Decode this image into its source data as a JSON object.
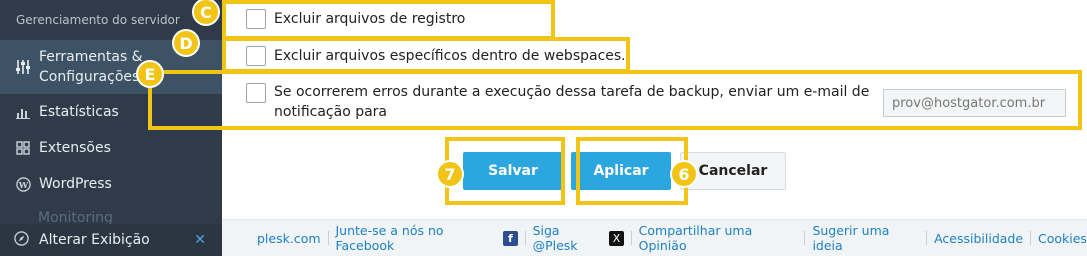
{
  "sidebar": {
    "section_title": "Gerenciamento do servidor",
    "items": [
      {
        "label_line1": "Ferramentas &",
        "label_line2": "Configurações",
        "icon": "sliders-icon"
      },
      {
        "label": "Estatísticas",
        "icon": "bar-chart-icon"
      },
      {
        "label": "Extensões",
        "icon": "extensions-icon"
      },
      {
        "label": "WordPress",
        "icon": "wordpress-icon"
      }
    ],
    "faded_item": "Monitoring",
    "bottom": {
      "label": "Alterar Exibição",
      "icon": "compass-icon",
      "close_icon": "close-icon"
    }
  },
  "options": {
    "exclude_logs": "Excluir arquivos de registro",
    "exclude_specific": "Excluir arquivos específicos dentro de webspaces.",
    "notify_line1": "Se ocorrerem erros durante a execução dessa tarefa de backup, enviar um e-mail de",
    "notify_line2": "notificação para",
    "email_value": "prov@hostgator.com.br"
  },
  "buttons": {
    "save": "Salvar",
    "apply": "Aplicar",
    "cancel": "Cancelar"
  },
  "badges": {
    "c": "C",
    "d": "D",
    "e": "E",
    "seven": "7",
    "six": "6"
  },
  "footer": {
    "links": [
      "plesk.com",
      "Junte-se a nós no Facebook",
      "Siga @Plesk",
      "Compartilhar uma Opinião",
      "Sugerir uma ideia",
      "Acessibilidade",
      "Cookies"
    ],
    "fb_glyph": "f",
    "x_glyph": "X"
  },
  "colors": {
    "highlight": "#f2c416",
    "primary": "#2ba6de",
    "sidebar": "#2f3b48",
    "link": "#1f80c3"
  }
}
